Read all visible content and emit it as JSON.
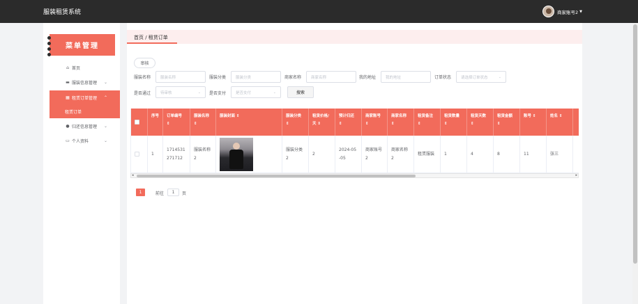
{
  "app": {
    "title": "服装租赁系统"
  },
  "user": {
    "name": "商家账号2"
  },
  "sidebar": {
    "banner": "菜单管理",
    "items": [
      {
        "label": "首页",
        "icon": "home-icon",
        "glyph": "⌂",
        "chev": ""
      },
      {
        "label": "服装信息管理",
        "icon": "cart-icon",
        "glyph": "▬",
        "chev": "⌄"
      },
      {
        "label": "租赁订单管理",
        "icon": "grid-icon",
        "glyph": "▦",
        "chev": "⌃"
      },
      {
        "label": "租赁订单",
        "icon": "",
        "glyph": "",
        "chev": ""
      },
      {
        "label": "归还信息管理",
        "icon": "location-icon",
        "glyph": "●",
        "chev": "⌄"
      },
      {
        "label": "个人资料",
        "icon": "id-card-icon",
        "glyph": "▭",
        "chev": "⌄"
      }
    ]
  },
  "breadcrumb": "首页 / 租赁订单",
  "toolbar": {
    "audit_label": "审核",
    "search_label": "搜索"
  },
  "filters": {
    "name": {
      "label": "服装名称",
      "placeholder": "服装名称"
    },
    "category": {
      "label": "服装分类",
      "placeholder": "服装分类"
    },
    "merchant": {
      "label": "商家名称",
      "placeholder": "商家名称"
    },
    "address": {
      "label": "我的地址",
      "placeholder": "我的地址"
    },
    "status": {
      "label": "订单状态",
      "placeholder": "请选择订单状态"
    },
    "passed": {
      "label": "是否通过",
      "placeholder": "待审核"
    },
    "paid": {
      "label": "是否支付",
      "placeholder": "是否支付"
    }
  },
  "table": {
    "headers": [
      "",
      "序号",
      "订单编号 ⇕",
      "服装名称 ⇕",
      "服装封面 ⇕",
      "服装分类 ⇕",
      "租赁价格/天 ⇕",
      "预计归还 ⇕",
      "商家账号 ⇕",
      "商家名称 ⇕",
      "租赁备注 ⇕",
      "租赁数量 ⇕",
      "租赁天数 ⇕",
      "租赁金额 ⇕",
      "账号 ⇕",
      "姓名 ⇕"
    ],
    "rows": [
      [
        "",
        "1",
        "1714531271712",
        "服装名称2",
        "",
        "服装分类2",
        "2",
        "2024-05-05",
        "商家账号2",
        "商家名称2",
        "租赁服装",
        "1",
        "4",
        "8",
        "11",
        "张三"
      ]
    ]
  },
  "pagination": {
    "current": "1",
    "goto_label": "前往",
    "goto_value": "1",
    "page_suffix": "页"
  },
  "colors": {
    "accent": "#f26b5b",
    "topbar": "#2b2b2b"
  }
}
